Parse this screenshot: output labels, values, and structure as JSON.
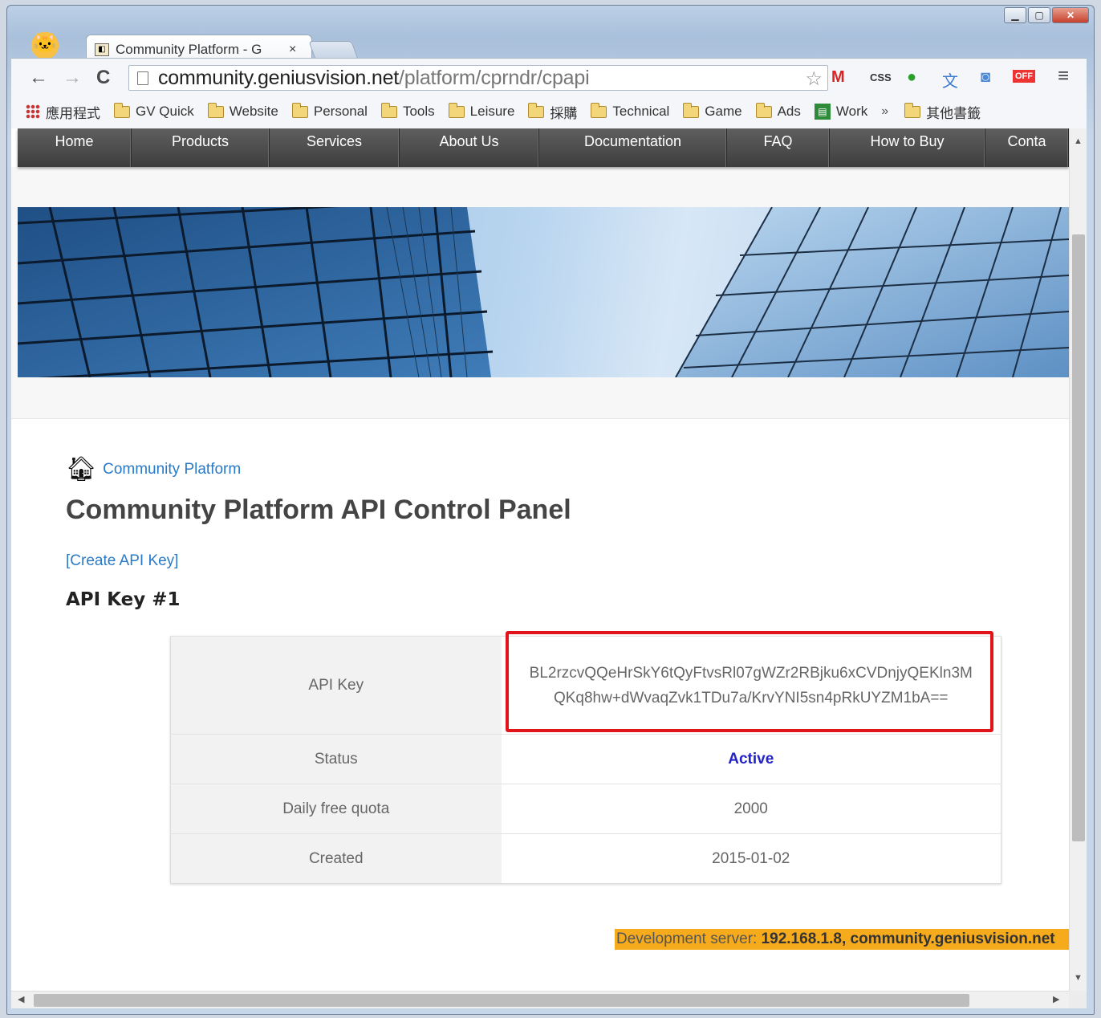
{
  "browser": {
    "tab_title": "Community Platform - G",
    "tab_close": "×",
    "url_host": "community.geniusvision.net",
    "url_path": "/platform/cprndr/cpapi",
    "bookmarks": [
      {
        "label": "應用程式",
        "icon": "apps-icon"
      },
      {
        "label": "GV Quick",
        "icon": "folder-icon"
      },
      {
        "label": "Website",
        "icon": "folder-icon"
      },
      {
        "label": "Personal",
        "icon": "folder-icon"
      },
      {
        "label": "Tools",
        "icon": "folder-icon"
      },
      {
        "label": "Leisure",
        "icon": "folder-icon"
      },
      {
        "label": "採購",
        "icon": "folder-icon"
      },
      {
        "label": "Technical",
        "icon": "folder-icon"
      },
      {
        "label": "Game",
        "icon": "folder-icon"
      },
      {
        "label": "Ads",
        "icon": "folder-icon"
      },
      {
        "label": "Work",
        "icon": "sheet-icon"
      }
    ],
    "bookmarks_more": "»",
    "other_bookmarks": "其他書籤",
    "ext_css": "CSS",
    "ext_off": "OFF"
  },
  "site_nav": [
    {
      "label": "Home",
      "width": 142
    },
    {
      "label": "Products",
      "width": 172
    },
    {
      "label": "Services",
      "width": 162
    },
    {
      "label": "About Us",
      "width": 174
    },
    {
      "label": "Documentation",
      "width": 234
    },
    {
      "label": "FAQ",
      "width": 128
    },
    {
      "label": "How to Buy",
      "width": 194
    },
    {
      "label": "Conta",
      "width": 104
    }
  ],
  "breadcrumb": {
    "label": "Community Platform"
  },
  "page": {
    "title": "Community Platform API Control Panel",
    "create_link": "[Create API Key]",
    "key_heading": "API Key #1"
  },
  "api_key_table": {
    "rows": [
      {
        "label": "API Key",
        "value": "BL2rzcvQQeHrSkY6tQyFtvsRl07gWZr2RBjku6xCVDnjyQEKln3MQKq8hw+dWvaqZvk1TDu7a/KrvYNI5sn4pRkUYZM1bA=="
      },
      {
        "label": "Status",
        "value": "Active"
      },
      {
        "label": "Daily free quota",
        "value": "2000"
      },
      {
        "label": "Created",
        "value": "2015-01-02"
      }
    ]
  },
  "dev_banner": {
    "prefix": "Development server: ",
    "detail": "192.168.1.8, community.geniusvision.net"
  },
  "colors": {
    "link": "#2a7ac7",
    "status_active": "#2323c8",
    "highlight": "#e0141a",
    "banner": "#f6ab1d"
  }
}
